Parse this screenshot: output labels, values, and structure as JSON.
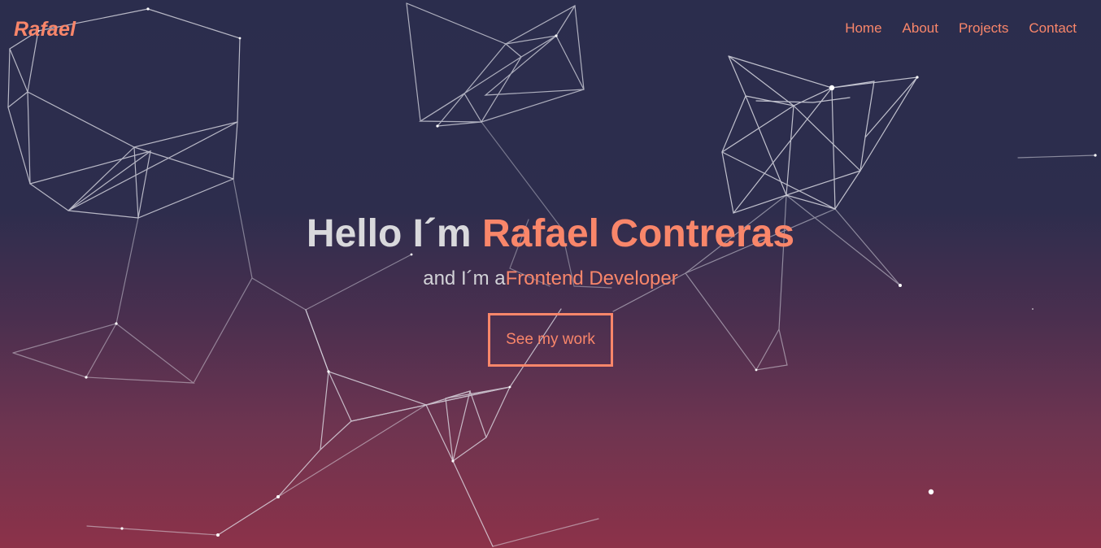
{
  "brand": {
    "logo_text": "Rafael",
    "accent_color": "#f9866a"
  },
  "nav": {
    "items": [
      {
        "label": "Home"
      },
      {
        "label": "About"
      },
      {
        "label": "Projects"
      },
      {
        "label": "Contact"
      }
    ]
  },
  "hero": {
    "greeting": "Hello I´m ",
    "name": "Rafael Contreras",
    "subtitle_prefix": "and I´m a",
    "role": "Frontend Developer",
    "cta_label": "See my work"
  },
  "background": {
    "gradient_top": "#2b2d4d",
    "gradient_bottom": "#8c3249",
    "line_color": "#e6e6ee"
  }
}
